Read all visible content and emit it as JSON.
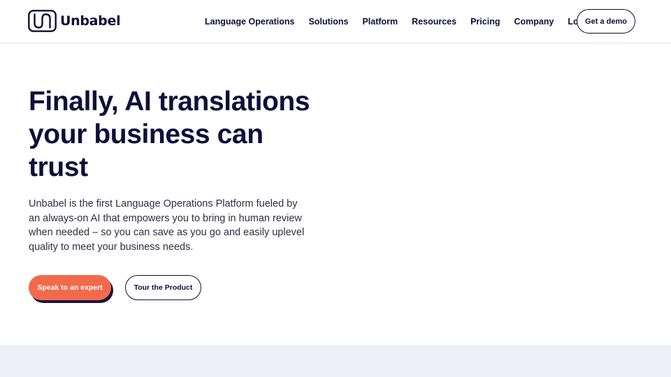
{
  "header": {
    "logo_text": "Unbabel",
    "nav": [
      {
        "label": "Language Operations"
      },
      {
        "label": "Solutions"
      },
      {
        "label": "Platform"
      },
      {
        "label": "Resources"
      },
      {
        "label": "Pricing"
      },
      {
        "label": "Company"
      },
      {
        "label": "Login"
      }
    ],
    "demo_label": "Get a demo"
  },
  "hero": {
    "title": "Finally, AI translations your business can trust",
    "description": "Unbabel is the first Language Operations Platform fueled by an always-on AI that empowers you to bring in human review when needed – so you can save as you go and easily uplevel quality to meet your business needs.",
    "primary_cta": "Speak to an expert",
    "secondary_cta": "Tour the Product"
  },
  "colors": {
    "navy": "#0f0f3a",
    "accent": "#f26a4b",
    "band": "#edf0f8"
  },
  "icons": {
    "logo": "unbabel-logo-icon"
  }
}
